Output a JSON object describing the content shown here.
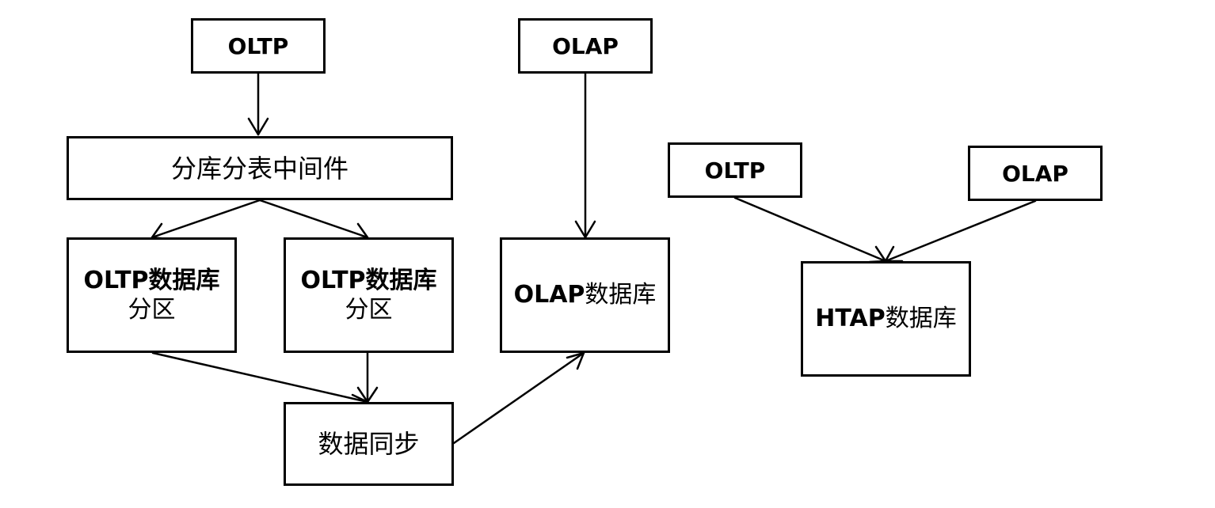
{
  "boxes": {
    "oltp_top": "OLTP",
    "olap_top": "OLAP",
    "middleware": "分库分表中间件",
    "partition1": {
      "prefix": "OLTP",
      "suffix": "数据库",
      "line2": "分区"
    },
    "partition2": {
      "prefix": "OLTP",
      "suffix": "数据库",
      "line2": "分区"
    },
    "olap_db": {
      "prefix": "OLAP",
      "suffix": "数据库"
    },
    "data_sync": "数据同步",
    "oltp_right": "OLTP",
    "olap_right": "OLAP",
    "htap_db": {
      "prefix": "HTAP",
      "suffix": "数据库"
    }
  },
  "colors": {
    "line": "#000000",
    "background": "#ffffff"
  }
}
